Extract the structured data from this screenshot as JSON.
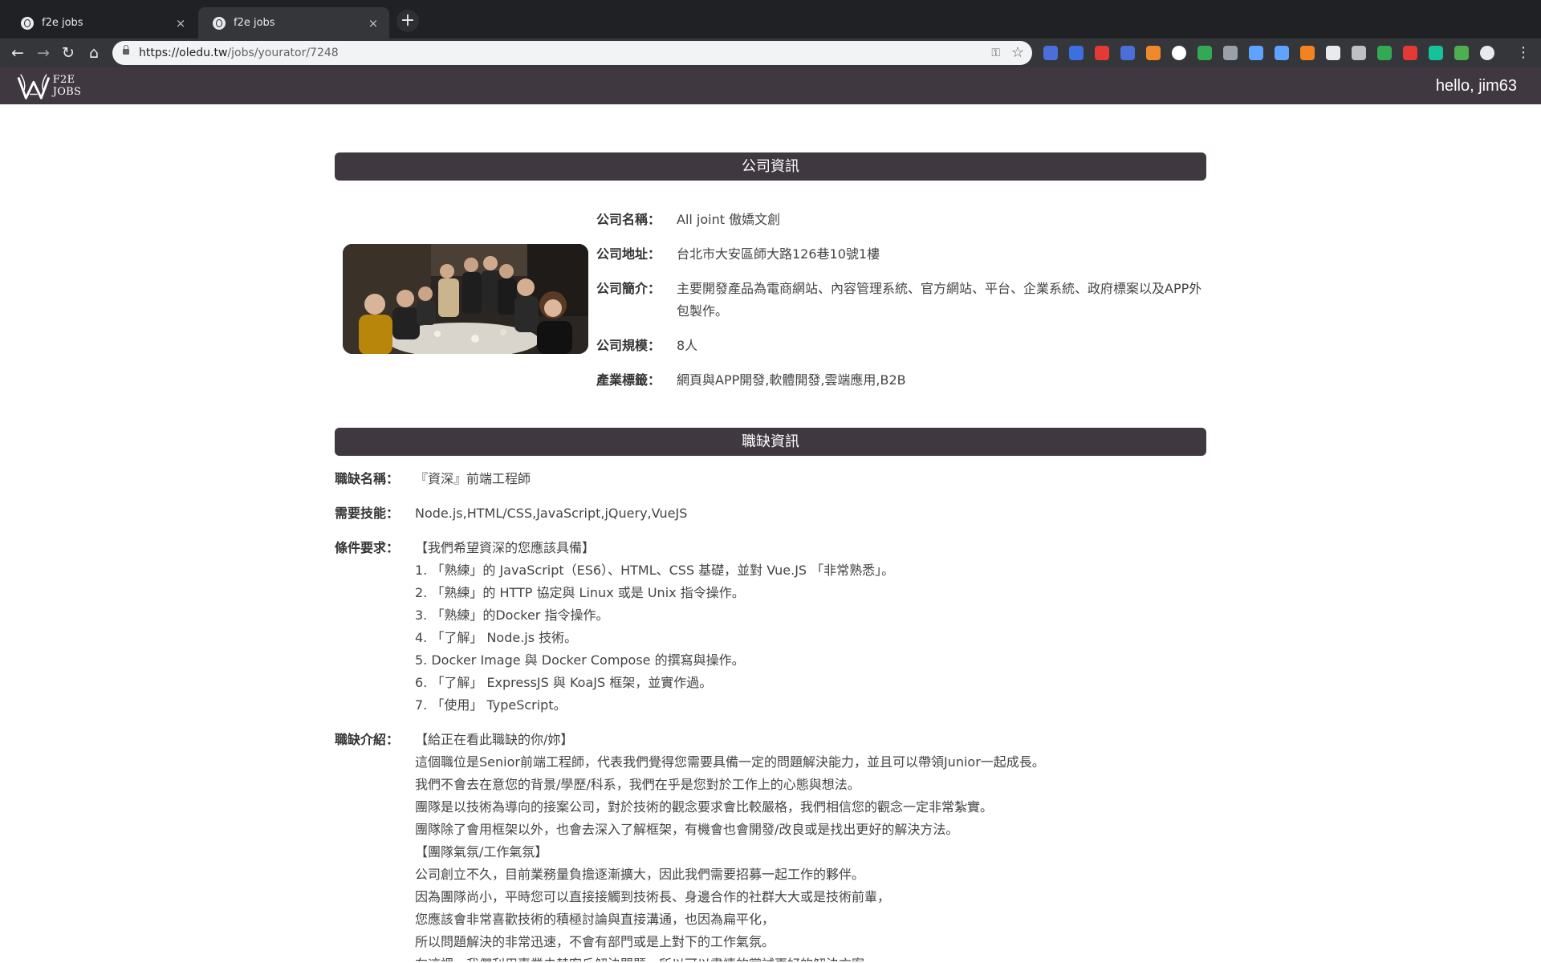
{
  "browser": {
    "tabs": [
      {
        "title": "f2e jobs",
        "close": "×"
      },
      {
        "title": "f2e jobs",
        "close": "×"
      }
    ],
    "new_tab": "+",
    "url_host": "https://oledu.tw",
    "url_path": "/jobs/yourator/7248",
    "extension_colors": [
      "#4a6fd8",
      "#3d6fe0",
      "#e53935",
      "#4a6fd8",
      "#f0892a",
      "#ffffff",
      "#34a853",
      "#9aa0a6",
      "#5ea3ff",
      "#5ea3ff",
      "#f58220",
      "#e8eaed",
      "#bdc1c6",
      "#34a853",
      "#e53935",
      "#15c39a",
      "#4caf50",
      "#e8eaed"
    ]
  },
  "site": {
    "logo_text": "F2E JOBS",
    "greeting": "hello, jim63"
  },
  "company": {
    "section_title": "公司資訊",
    "name_label": "公司名稱：",
    "name": "All joint 傲嬌文創",
    "address_label": "公司地址：",
    "address": "台北市大安區師大路126巷10號1樓",
    "intro_label": "公司簡介：",
    "intro_lines": [
      "主要開發產品為電商網站、內容管理系統、官方網站、平台、企業系統、政府標案以及APP外",
      "包製作。"
    ],
    "size_label": "公司規模：",
    "size": "8人",
    "industry_label": "產業標籤：",
    "industry": "網頁與APP開發,軟體開發,雲端應用,B2B"
  },
  "job": {
    "section_title": "職缺資訊",
    "title_label": "職缺名稱：",
    "title": "『資深』前端工程師",
    "skills_label": "需要技能：",
    "skills": "Node.js,HTML/CSS,JavaScript,jQuery,VueJS",
    "requirements_label": "條件要求：",
    "requirements": [
      "【我們希望資深的您應該具備】",
      "1. 「熟練」的 JavaScript（ES6）、HTML、CSS 基礎，並對 Vue.JS 「非常熟悉」。",
      "2. 「熟練」的 HTTP 協定與 Linux 或是 Unix 指令操作。",
      "3. 「熟練」的Docker 指令操作。",
      "4. 「了解」 Node.js 技術。",
      "5. Docker Image 與 Docker Compose 的撰寫與操作。",
      "6. 「了解」 ExpressJS 與 KoaJS 框架，並實作過。",
      "7. 「使用」 TypeScript。"
    ],
    "description_label": "職缺介紹：",
    "description": [
      "【給正在看此職缺的你/妳】",
      "這個職位是Senior前端工程師，代表我們覺得您需要具備一定的問題解決能力，並且可以帶領Junior一起成長。",
      "我們不會去在意您的背景/學歷/科系，我們在乎是您對於工作上的心態與想法。",
      "團隊是以技術為導向的接案公司，對於技術的觀念要求會比較嚴格，我們相信您的觀念一定非常紮實。",
      "團隊除了會用框架以外，也會去深入了解框架，有機會也會開發/改良或是找出更好的解決方法。",
      "【團隊氣氛/工作氣氛】",
      "公司創立不久，目前業務量負擔逐漸擴大，因此我們需要招募一起工作的夥伴。",
      "因為團隊尚小，平時您可以直接接觸到技術長、身邊合作的社群大大或是技術前輩，",
      "您應該會非常喜歡技術的積極討論與直接溝通，也因為扁平化，",
      "所以問題解決的非常迅速，不會有部門或是上對下的工作氣氛。",
      "在這裡，我們利用專業去替客戶解決問題，所以可以盡情的嘗試更好的解決方案。"
    ]
  }
}
